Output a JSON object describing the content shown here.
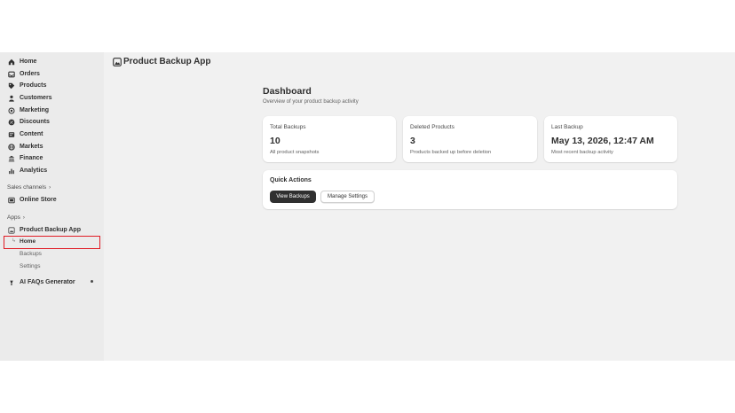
{
  "sidebar": {
    "items": [
      {
        "label": "Home",
        "icon": "home-icon"
      },
      {
        "label": "Orders",
        "icon": "inbox-icon"
      },
      {
        "label": "Products",
        "icon": "tag-icon"
      },
      {
        "label": "Customers",
        "icon": "person-icon"
      },
      {
        "label": "Marketing",
        "icon": "target-icon"
      },
      {
        "label": "Discounts",
        "icon": "discount-icon"
      },
      {
        "label": "Content",
        "icon": "content-icon"
      },
      {
        "label": "Markets",
        "icon": "globe-icon"
      },
      {
        "label": "Finance",
        "icon": "bank-icon"
      },
      {
        "label": "Analytics",
        "icon": "chart-icon"
      }
    ],
    "sales_channels_label": "Sales channels",
    "online_store_label": "Online Store",
    "apps_label": "Apps",
    "app_name": "Product Backup App",
    "app_sub_items": [
      "Home",
      "Backups",
      "Settings"
    ],
    "faq_app_label": "AI FAQs Generator"
  },
  "header": {
    "app_title": "Product Backup App"
  },
  "main": {
    "title": "Dashboard",
    "subtitle": "Overview of your product backup activity",
    "cards": [
      {
        "label": "Total Backups",
        "value": "10",
        "description": "All product snapshots"
      },
      {
        "label": "Deleted Products",
        "value": "3",
        "description": "Products backed up before deletion"
      },
      {
        "label": "Last Backup",
        "value": "May 13, 2026, 12:47 AM",
        "description": "Most recent backup activity"
      }
    ],
    "quick_actions": {
      "title": "Quick Actions",
      "primary_label": "View Backups",
      "secondary_label": "Manage Settings"
    }
  },
  "colors": {
    "highlight_border": "#e01b24",
    "primary_button": "#303030",
    "sidebar_bg": "#ebebeb",
    "page_bg": "#f1f1f1"
  }
}
